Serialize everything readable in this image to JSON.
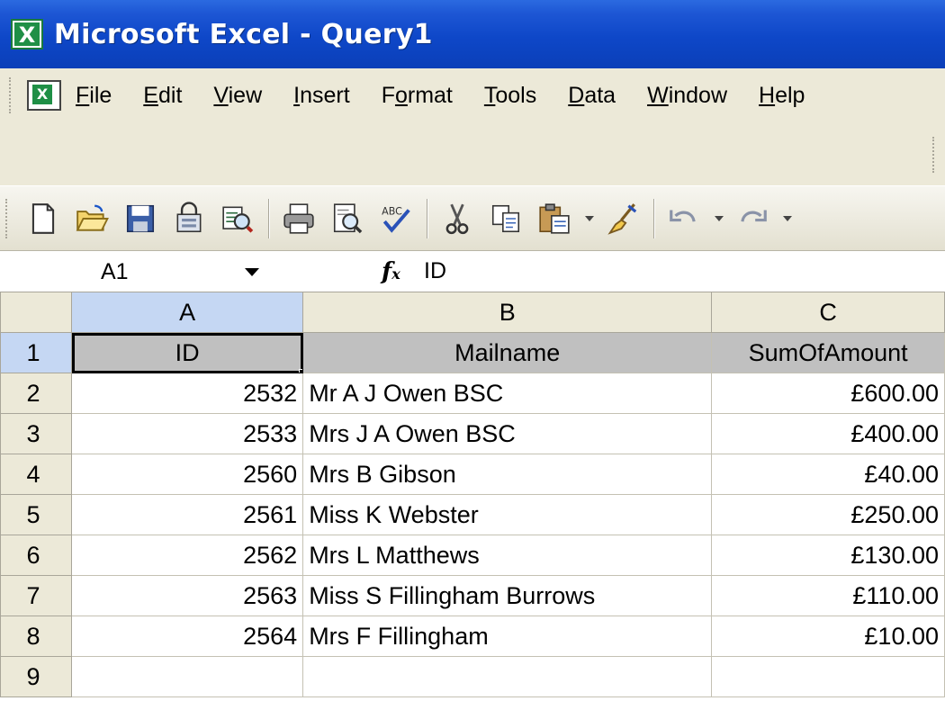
{
  "title": "Microsoft Excel - Query1",
  "menu": [
    {
      "label": "File",
      "u": "F",
      "rest": "ile"
    },
    {
      "label": "Edit",
      "u": "E",
      "rest": "dit"
    },
    {
      "label": "View",
      "u": "V",
      "rest": "iew"
    },
    {
      "label": "Insert",
      "u": "I",
      "rest": "nsert"
    },
    {
      "label": "Format",
      "pre": "F",
      "u": "o",
      "rest": "rmat"
    },
    {
      "label": "Tools",
      "u": "T",
      "rest": "ools"
    },
    {
      "label": "Data",
      "u": "D",
      "rest": "ata"
    },
    {
      "label": "Window",
      "u": "W",
      "rest": "indow"
    },
    {
      "label": "Help",
      "u": "H",
      "rest": "elp"
    }
  ],
  "toolbar_icons": [
    "new-icon",
    "open-icon",
    "save-icon",
    "permission-icon",
    "research-icon",
    "print-icon",
    "print-preview-icon",
    "spelling-icon",
    "cut-icon",
    "copy-icon",
    "paste-icon",
    "format-painter-icon",
    "undo-icon",
    "redo-icon"
  ],
  "formula_bar": {
    "name_box": "A1",
    "fx": "fx",
    "value": "ID"
  },
  "columns": [
    "A",
    "B",
    "C"
  ],
  "header_row": {
    "row": "1",
    "cells": [
      "ID",
      "Mailname",
      "SumOfAmount"
    ]
  },
  "rows": [
    {
      "row": "2",
      "id": "2532",
      "name": "Mr A J Owen BSC",
      "amount": "£600.00"
    },
    {
      "row": "3",
      "id": "2533",
      "name": "Mrs J A Owen BSC",
      "amount": "£400.00"
    },
    {
      "row": "4",
      "id": "2560",
      "name": "Mrs B Gibson",
      "amount": "£40.00"
    },
    {
      "row": "5",
      "id": "2561",
      "name": "Miss K Webster",
      "amount": "£250.00"
    },
    {
      "row": "6",
      "id": "2562",
      "name": "Mrs  L Matthews",
      "amount": "£130.00"
    },
    {
      "row": "7",
      "id": "2563",
      "name": "Miss S Fillingham Burrows",
      "amount": "£110.00"
    },
    {
      "row": "8",
      "id": "2564",
      "name": "Mrs F Fillingham",
      "amount": "£10.00"
    },
    {
      "row": "9",
      "id": "",
      "name": "",
      "amount": ""
    }
  ],
  "colors": {
    "title_bar": "#0e47c8",
    "header_fill": "#c0c0c0",
    "active_header": "#c5d7f3"
  }
}
